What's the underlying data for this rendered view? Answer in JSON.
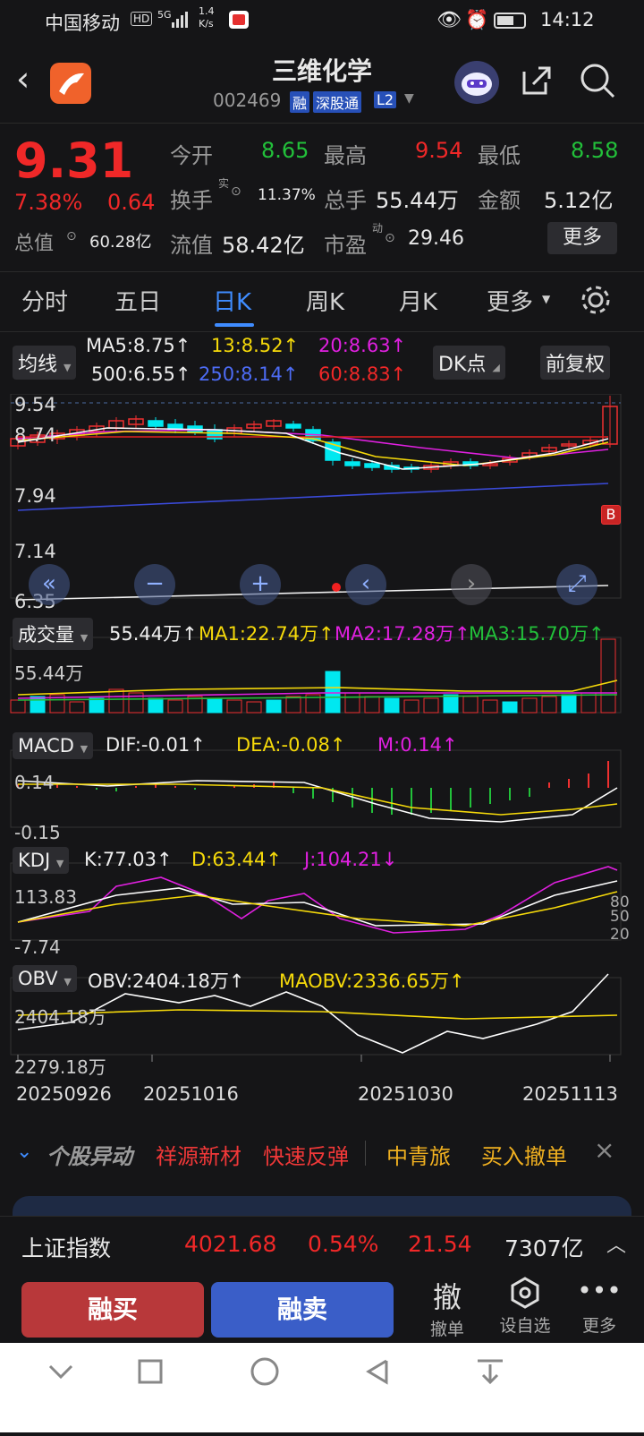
{
  "status": {
    "carrier": "中国移动",
    "hd": "HD",
    "net": "5G",
    "speed": "1.4 K/s",
    "time": "14:12"
  },
  "header": {
    "title": "三维化学",
    "code": "002469",
    "badge_rong": "融",
    "badge_sgt": "深股通",
    "badge_l2": "L2"
  },
  "quote": {
    "price": "9.31",
    "pct": "7.38%",
    "chg": "0.64",
    "open_label": "今开",
    "open": "8.65",
    "high_label": "最高",
    "high": "9.54",
    "low_label": "最低",
    "low": "8.58",
    "turnover_label": "换手",
    "turnover_sup": "实",
    "turnover": "11.37%",
    "vol_label": "总手",
    "vol": "55.44万",
    "amt_label": "金额",
    "amt": "5.12亿",
    "mcap_label": "总值",
    "mcap": "60.28亿",
    "float_label": "流值",
    "float": "58.42亿",
    "pe_label": "市盈",
    "pe_sup": "动",
    "pe": "29.46",
    "more": "更多"
  },
  "tabs": [
    "分时",
    "五日",
    "日K",
    "周K",
    "月K",
    "更多"
  ],
  "ma": {
    "selector": "均线",
    "ma5": "MA5:8.75↑",
    "ma13": "13:8.52↑",
    "ma20": "20:8.63↑",
    "ma500": "500:6.55↑",
    "ma250": "250:8.14↑",
    "ma60": "60:8.83↑",
    "dk": "DK点",
    "fq": "前复权"
  },
  "kline": {
    "y1": "9.54",
    "y2": "8.74",
    "y3": "7.94",
    "y4": "7.14",
    "y5": "6.35",
    "b_mark": "B"
  },
  "volume": {
    "selector": "成交量",
    "val": "55.44万↑",
    "ma1": "MA1:22.74万↑",
    "ma2": "MA2:17.28万↑",
    "ma3": "MA3:15.70万↑",
    "ylabel": "55.44万"
  },
  "macd": {
    "selector": "MACD",
    "dif": "DIF:-0.01↑",
    "dea": "DEA:-0.08↑",
    "m": "M:0.14↑",
    "y1": "0.14",
    "y2": "-0.15"
  },
  "kdj": {
    "selector": "KDJ",
    "k": "K:77.03↑",
    "d": "D:63.44↑",
    "j": "J:104.21↓",
    "y1": "113.83",
    "y2": "-7.74",
    "r80": "80",
    "r50": "50",
    "r20": "20"
  },
  "obv": {
    "selector": "OBV",
    "obv": "OBV:2404.18万↑",
    "maobv": "MAOBV:2336.65万↑",
    "y1": "2404.18万",
    "y2": "2279.18万"
  },
  "dates": [
    "20250926",
    "20251016",
    "20251030",
    "20251113"
  ],
  "news": {
    "tag": "个股异动",
    "item1": "祥源新材",
    "item2": "快速反弹",
    "item3": "中青旅",
    "item4": "买入撤单"
  },
  "index": {
    "name": "上证指数",
    "val": "4021.68",
    "pct": "0.54%",
    "chg": "21.54",
    "amt": "7307亿"
  },
  "actions": {
    "buy": "融买",
    "sell": "融卖",
    "cancel_big": "撤",
    "cancel": "撤单",
    "watch": "设自选",
    "more": "更多"
  }
}
